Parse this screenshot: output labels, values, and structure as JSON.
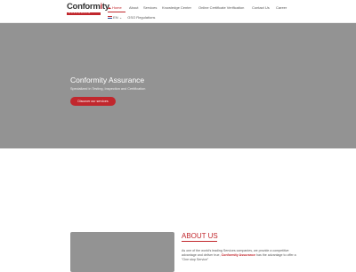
{
  "logo": {
    "name_main": "Conform",
    "name_dot": "i",
    "name_end": "ty",
    "tagline": "ASSURANCE"
  },
  "nav": {
    "items": [
      {
        "label": "Home"
      },
      {
        "label": "About"
      },
      {
        "label": "Services"
      },
      {
        "label": "Knowledge Center"
      },
      {
        "label": "Online Certificate Verification"
      },
      {
        "label": "Contact Us"
      },
      {
        "label": "Career"
      }
    ],
    "language": "EN",
    "dropdown_caret": "⌄",
    "regulations": "GSO Regulations"
  },
  "hero": {
    "title": "Conformity Assurance",
    "subtitle": "Specialized in Testing, Inspection and Certification",
    "button": "Discover our services"
  },
  "about": {
    "title": "ABOUT US",
    "text_1": "As one of the world's leading Services companies, we provide a competitive advantage and deliver true",
    "brand": "Conformity Assurance",
    "text_2": "has the advantage to offer a \"One stop Service\""
  },
  "colors": {
    "accent": "#c1272d",
    "hero_bg": "#939393"
  }
}
